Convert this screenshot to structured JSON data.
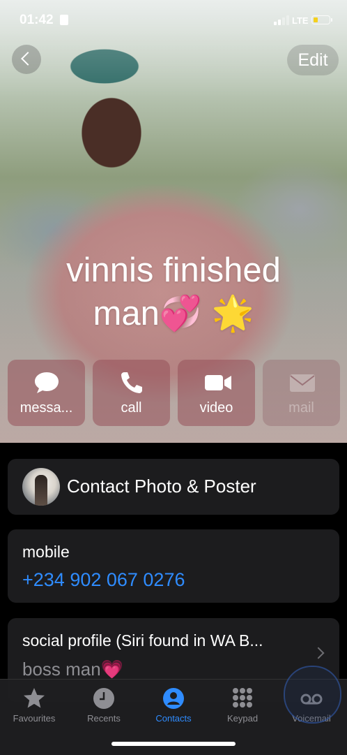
{
  "status": {
    "time": "01:42",
    "network": "LTE"
  },
  "nav": {
    "edit_label": "Edit"
  },
  "contact": {
    "name_line1": "vinnis finished",
    "name_line2": "man💞 🌟"
  },
  "actions": [
    {
      "label": "messa...",
      "icon": "message-icon",
      "enabled": true
    },
    {
      "label": "call",
      "icon": "phone-icon",
      "enabled": true
    },
    {
      "label": "video",
      "icon": "video-icon",
      "enabled": true
    },
    {
      "label": "mail",
      "icon": "mail-icon",
      "enabled": false
    }
  ],
  "photo_poster": {
    "label": "Contact Photo & Poster"
  },
  "mobile": {
    "label": "mobile",
    "number": "+234 902 067 0276"
  },
  "social": {
    "label": "social profile (Siri found in WA B...",
    "value": "boss man💗"
  },
  "tabs": [
    {
      "label": "Favourites",
      "icon": "star-icon"
    },
    {
      "label": "Recents",
      "icon": "clock-icon"
    },
    {
      "label": "Contacts",
      "icon": "person-icon",
      "active": true
    },
    {
      "label": "Keypad",
      "icon": "keypad-icon"
    },
    {
      "label": "Voicemail",
      "icon": "voicemail-icon"
    }
  ],
  "colors": {
    "accent": "#2f8cff",
    "battery": "#f4d01d",
    "card": "#1c1c1e"
  }
}
